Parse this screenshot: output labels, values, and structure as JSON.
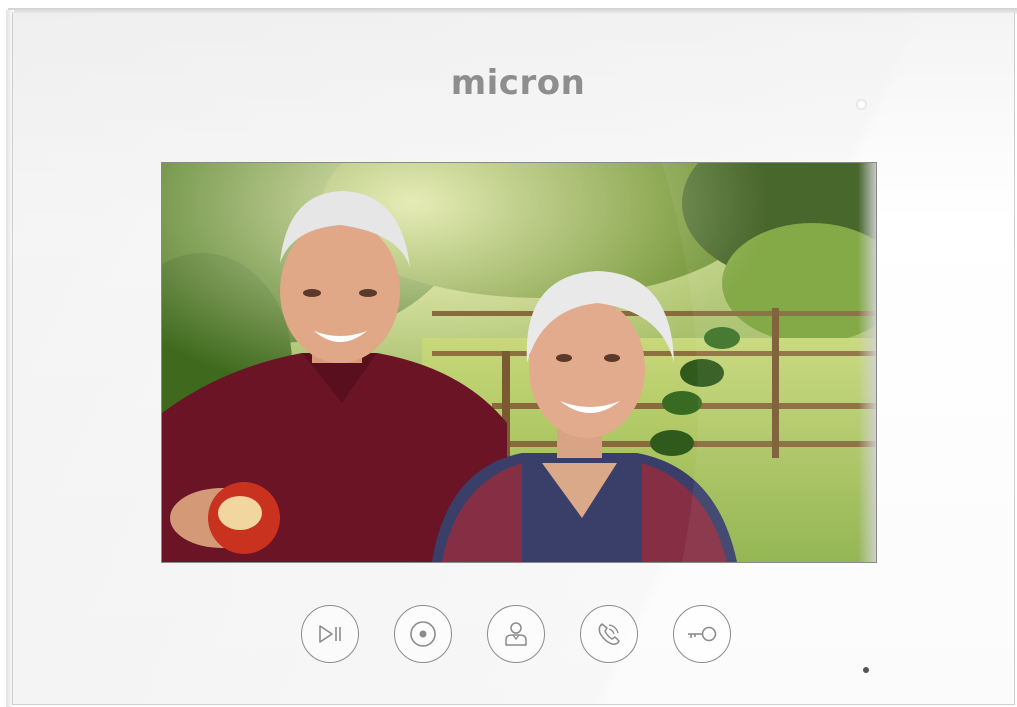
{
  "device": {
    "brand": "micron",
    "colors": {
      "body": "#ffffff",
      "brand_text": "#8e8e8e",
      "button_stroke": "#8c8c8c"
    }
  },
  "screen": {
    "image": "video-feed-photo"
  },
  "controls": [
    {
      "icon": "play-pause-icon"
    },
    {
      "icon": "record-icon"
    },
    {
      "icon": "person-icon"
    },
    {
      "icon": "phone-icon"
    },
    {
      "icon": "key-icon"
    }
  ]
}
